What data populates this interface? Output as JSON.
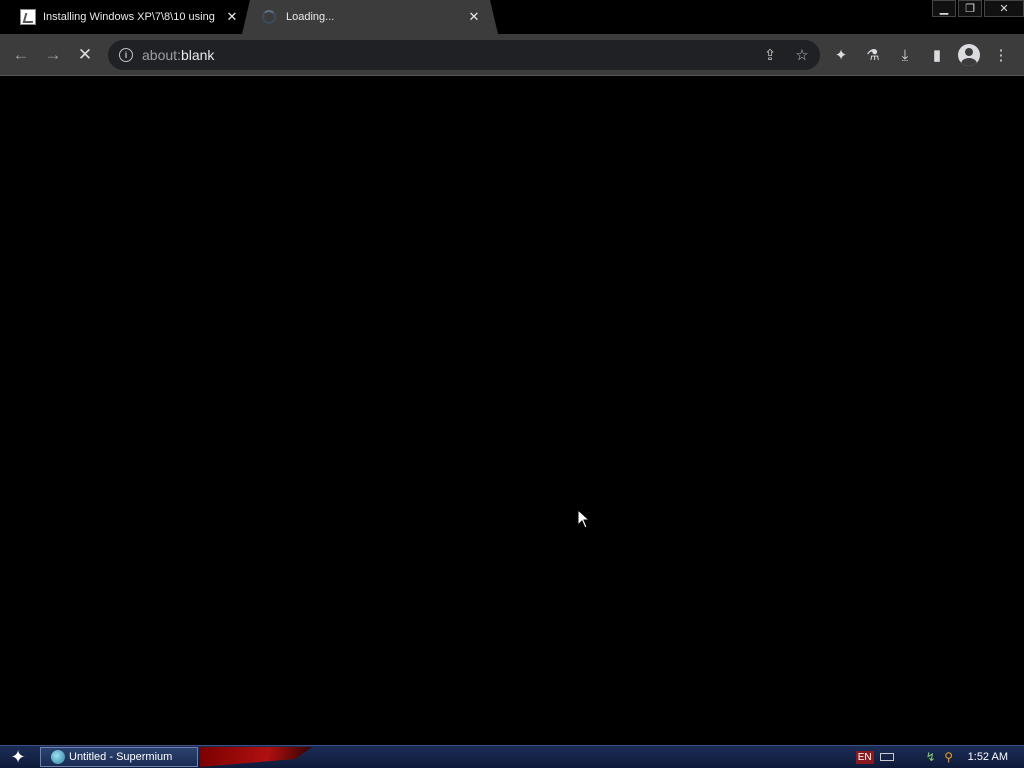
{
  "tabs": [
    {
      "title": "Installing Windows XP\\7\\8\\10 using",
      "favicon": "page-icon",
      "close": "✕"
    },
    {
      "title": "Loading...",
      "favicon": "loading-spinner-icon",
      "close": "✕"
    }
  ],
  "window_controls": {
    "minimize": "▁",
    "restore": "❐",
    "close": "✕"
  },
  "toolbar": {
    "back": "←",
    "forward": "→",
    "stop": "✕",
    "url_scheme": "about:",
    "url_host": "blank",
    "share": "⇪",
    "bookmark": "☆",
    "extensions": "✦",
    "labs": "⚗",
    "download": "⤓",
    "sidepanel": "▮",
    "menu": "⋮"
  },
  "taskbar": {
    "start": "✦",
    "task_label": "Untitled - Supermium",
    "lang": "EN",
    "clock": "1:52 AM"
  },
  "colors": {
    "tab_active": "#3c3c3c",
    "toolbar": "#3c3c3c",
    "omnibox": "#202124",
    "taskbar": "#1c2d56"
  }
}
